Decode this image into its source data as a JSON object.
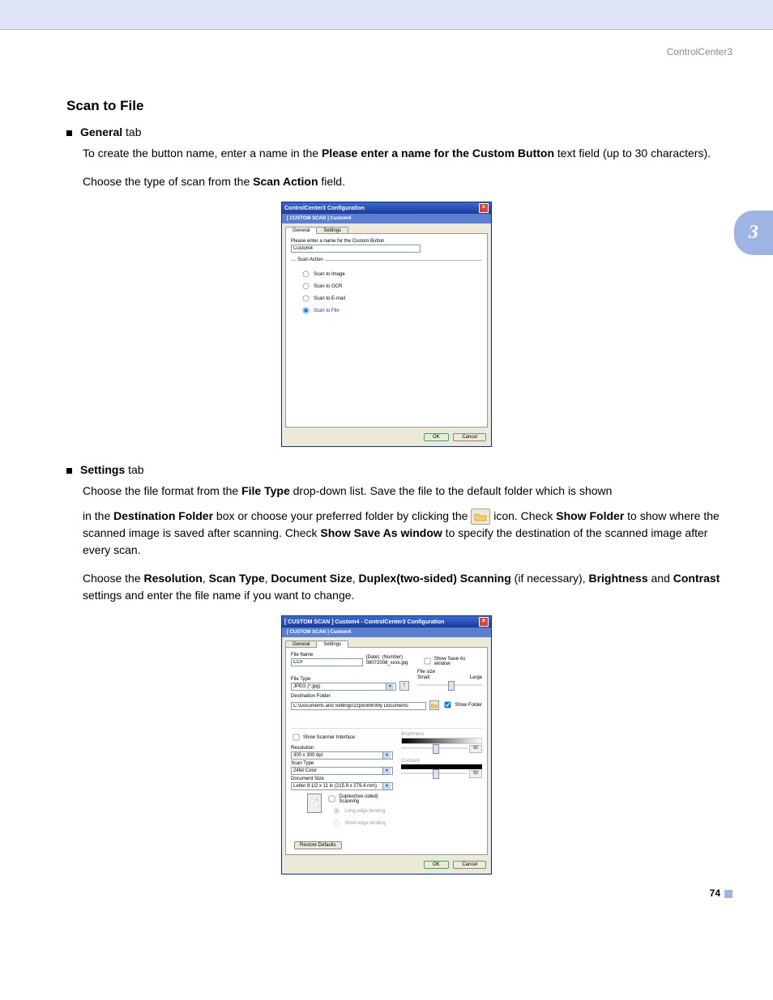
{
  "header": {
    "doc_title": "ControlCenter3"
  },
  "side_tab": "3",
  "page_number": "74",
  "section": {
    "title": "Scan to File",
    "general_tab_label": "General",
    "general_tab_suffix": " tab",
    "p1a": "To create the button name, enter a name in the ",
    "p1b": "Please enter a name for the Custom Button",
    "p1c": " text field (up to 30 characters).",
    "p2a": "Choose the type of scan from the ",
    "p2b": "Scan Action",
    "p2c": " field.",
    "settings_tab_label": "Settings",
    "settings_tab_suffix": " tab",
    "p3a": "Choose the file format from the ",
    "p3b": "File Type",
    "p3c": " drop-down list. Save the file to the default folder which is shown",
    "p4_pre": "in the ",
    "p4_df": "Destination Folder",
    "p4_mid": " box or choose your preferred folder by clicking the ",
    "p4_post": " icon. Check ",
    "p4_sf": "Show Folder",
    "p4_after_sf": " to show where the scanned image is saved after scanning. Check ",
    "p4_ssaw": "Show Save As window",
    "p4_end": " to specify the destination of the scanned image after every scan.",
    "p5a": "Choose the ",
    "p5_res": "Resolution",
    "p5_c1": ", ",
    "p5_st": "Scan Type",
    "p5_c2": ", ",
    "p5_ds": "Document Size",
    "p5_c3": ", ",
    "p5_dup": "Duplex(two-sided) Scanning",
    "p5_if": " (if necessary), ",
    "p5_br": "Brightness",
    "p5_and": " and ",
    "p5_con": "Contrast",
    "p5_end": " settings and enter the file name if you want to change."
  },
  "dialog1": {
    "title": "ControlCenter3 Configuration",
    "subtitle": "[  CUSTOM SCAN  ]   Custom4",
    "tabs": {
      "general": "General",
      "settings": "Settings"
    },
    "name_label": "Please enter a name for the Custom Button",
    "name_value": "Custom4",
    "scan_action_legend": "Scan Action",
    "radios": {
      "image": "Scan to Image",
      "ocr": "Scan to OCR",
      "email": "Scan to E-mail",
      "file": "Scan to File"
    },
    "ok": "OK",
    "cancel": "Cancel"
  },
  "dialog2": {
    "title": "[  CUSTOM SCAN  ]   Custom4  -  ControlCenter3 Configuration",
    "subtitle": "[  CUSTOM SCAN  ]   Custom4",
    "tabs": {
      "general": "General",
      "settings": "Settings"
    },
    "file_name_label": "File Name",
    "file_name_value": "CCF",
    "date_lbl": "(Date)",
    "number_lbl": "(Number)",
    "date_number_value": "08072008_xxxx.jpg",
    "show_save_as": "Show Save As window",
    "file_type_label": "File Type",
    "file_type_value": "JPEG (*.jpg)",
    "file_size_label": "File size",
    "fs_small": "Small",
    "fs_large": "Large",
    "dest_folder_label": "Destination Folder",
    "dest_folder_value": "C:\\Documents and Settings\\zzpx0890\\My Documents",
    "show_folder": "Show Folder",
    "show_scanner": "Show Scanner Interface",
    "resolution_label": "Resolution",
    "resolution_value": "300 x 300 dpi",
    "scan_type_label": "Scan Type",
    "scan_type_value": "24bit Color",
    "doc_size_label": "Document Size",
    "doc_size_value": "Letter 8 1/2 x 11 in (215.9 x 279.4 mm)",
    "duplex_label": "Duplex(two-sided) Scanning",
    "long_edge": "Long-edge binding",
    "short_edge": "Short-edge binding",
    "brightness_label": "Brightness",
    "contrast_label": "Contrast",
    "value50": "50",
    "restore": "Restore Defaults",
    "ok": "OK",
    "cancel": "Cancel"
  }
}
